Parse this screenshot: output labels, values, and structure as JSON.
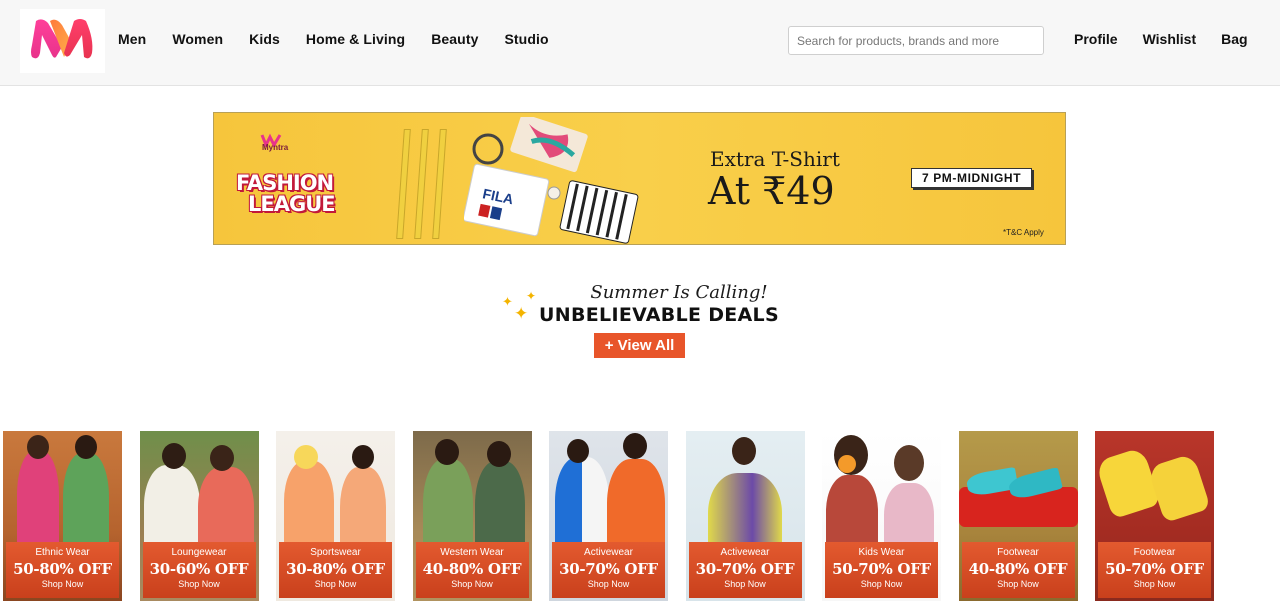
{
  "header": {
    "logo_alt": "Myntra",
    "nav": [
      "Men",
      "Women",
      "Kids",
      "Home & Living",
      "Beauty",
      "Studio"
    ],
    "search_placeholder": "Search for products, brands and more",
    "right_nav": [
      "Profile",
      "Wishlist",
      "Bag"
    ]
  },
  "banner": {
    "brand": "Myntra",
    "campaign_line1": "FASHION",
    "campaign_line2": "LEAGUE",
    "offer_line1": "Extra T-Shirt",
    "offer_line2": "At ₹49",
    "time": "7 PM-MIDNIGHT",
    "terms": "*T&C Apply"
  },
  "deals": {
    "subtitle": "Summer Is Calling!",
    "title": "UNBELIEVABLE DEALS",
    "view_all": "+ View All"
  },
  "cards": [
    {
      "category": "Ethnic Wear",
      "discount": "50-80% OFF",
      "cta": "Shop Now"
    },
    {
      "category": "Loungewear",
      "discount": "30-60% OFF",
      "cta": "Shop Now"
    },
    {
      "category": "Sportswear",
      "discount": "30-80% OFF",
      "cta": "Shop Now"
    },
    {
      "category": "Western Wear",
      "discount": "40-80% OFF",
      "cta": "Shop Now"
    },
    {
      "category": "Activewear",
      "discount": "30-70% OFF",
      "cta": "Shop Now"
    },
    {
      "category": "Activewear",
      "discount": "30-70% OFF",
      "cta": "Shop Now"
    },
    {
      "category": "Kids Wear",
      "discount": "50-70% OFF",
      "cta": "Shop Now"
    },
    {
      "category": "Footwear",
      "discount": "40-80% OFF",
      "cta": "Shop Now"
    },
    {
      "category": "Footwear",
      "discount": "50-70% OFF",
      "cta": "Shop Now"
    }
  ],
  "colors": {
    "accent": "#e8552a",
    "banner_bg": "#f6c53c",
    "logo_pink": "#ff3f6c",
    "logo_orange": "#ff905a"
  }
}
